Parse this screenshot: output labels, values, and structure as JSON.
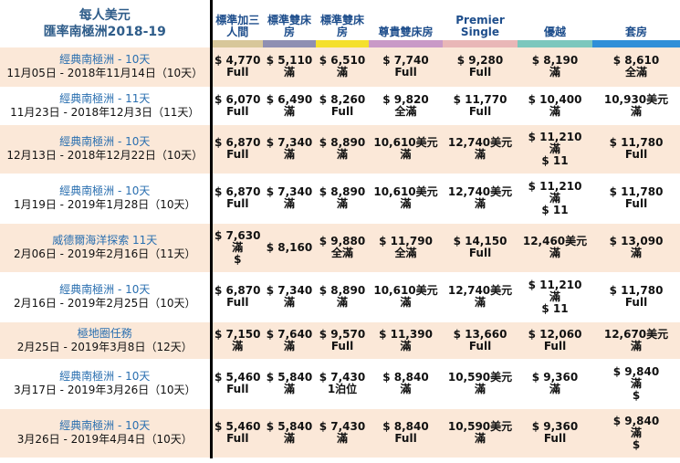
{
  "header": {
    "title": "每人美元",
    "subtitle": "匯率南極洲2018-19",
    "columns": [
      {
        "label": "標準加三人間",
        "color": "#d8c79a"
      },
      {
        "label": "標準雙床房",
        "color": "#8f8fb2"
      },
      {
        "label": "標準雙床房",
        "color": "#f4e02d"
      },
      {
        "label": "尊貴雙床房",
        "color": "#c99ac7"
      },
      {
        "label": "Premier Single",
        "color": "#e9b7b7"
      },
      {
        "label": "優越",
        "color": "#7cc7bd"
      },
      {
        "label": "套房",
        "color": "#2f8fd8"
      }
    ]
  },
  "rows": [
    {
      "tour": "經典南極洲 - 10天",
      "dates": "11月05日 - 2018年11月14日（10天）",
      "cells": [
        [
          "$ 4,770",
          "Full"
        ],
        [
          "$ 5,110",
          "滿"
        ],
        [
          "$ 6,510",
          "滿"
        ],
        [
          "$ 7,740",
          "Full"
        ],
        [
          "$ 9,280",
          "Full"
        ],
        [
          "$ 8,190",
          "滿"
        ],
        [
          "$ 8,610",
          "全滿"
        ]
      ]
    },
    {
      "tour": "經典南極洲 - 11天",
      "dates": "11月23日 - 2018年12月3日（11天）",
      "cells": [
        [
          "$ 6,070",
          "Full"
        ],
        [
          "$ 6,490",
          "滿"
        ],
        [
          "$ 8,260",
          "Full"
        ],
        [
          "$ 9,820",
          "全滿"
        ],
        [
          "$ 11,770",
          "Full"
        ],
        [
          "$ 10,400",
          "滿"
        ],
        [
          "10,930美元",
          "滿"
        ]
      ]
    },
    {
      "tour": "經典南極洲 - 10天",
      "dates": "12月13日 - 2018年12月22日（10天）",
      "cells": [
        [
          "$ 6,870",
          "Full"
        ],
        [
          "$ 7,340",
          "滿"
        ],
        [
          "$ 8,890",
          "滿"
        ],
        [
          "10,610美元",
          "滿"
        ],
        [
          "12,740美元",
          "滿"
        ],
        [
          "$ 11,210",
          "滿",
          "$ 11"
        ],
        [
          "$ 11,780",
          "Full"
        ]
      ]
    },
    {
      "tour": "經典南極洲 - 10天",
      "dates": "1月19日 - 2019年1月28日（10天）",
      "cells": [
        [
          "$ 6,870",
          "Full"
        ],
        [
          "$ 7,340",
          "滿"
        ],
        [
          "$ 8,890",
          "滿"
        ],
        [
          "10,610美元",
          "滿"
        ],
        [
          "12,740美元",
          "滿"
        ],
        [
          "$ 11,210",
          "滿",
          "$ 11"
        ],
        [
          "$ 11,780",
          "Full"
        ]
      ]
    },
    {
      "tour": "威德爾海洋探索 11天",
      "dates": "2月06日 - 2019年2月16日（11天）",
      "cells": [
        [
          "$ 7,630",
          "滿",
          "$"
        ],
        [
          "$ 8,160"
        ],
        [
          "$ 9,880",
          "全滿"
        ],
        [
          "$ 11,790",
          "全滿"
        ],
        [
          "$ 14,150",
          "Full"
        ],
        [
          "12,460美元",
          "滿"
        ],
        [
          "$ 13,090",
          "滿"
        ]
      ]
    },
    {
      "tour": "經典南極洲 - 10天",
      "dates": "2月16日 - 2019年2月25日（10天）",
      "cells": [
        [
          "$ 6,870",
          "Full"
        ],
        [
          "$ 7,340",
          "滿"
        ],
        [
          "$ 8,890",
          "滿"
        ],
        [
          "10,610美元",
          "滿"
        ],
        [
          "12,740美元",
          "滿"
        ],
        [
          "$ 11,210",
          "滿",
          "$ 11"
        ],
        [
          "$ 11,780",
          "Full"
        ]
      ]
    },
    {
      "tour": "極地圈任務",
      "dates": "2月25日 - 2019年3月8日（12天）",
      "cells": [
        [
          "$ 7,150",
          "滿"
        ],
        [
          "$ 7,640",
          "滿"
        ],
        [
          "$ 9,570",
          "Full"
        ],
        [
          "$ 11,390",
          "滿"
        ],
        [
          "$ 13,660",
          "Full"
        ],
        [
          "$ 12,060",
          "Full"
        ],
        [
          "12,670美元",
          "滿"
        ]
      ]
    },
    {
      "tour": "經典南極洲 - 10天",
      "dates": "3月17日 - 2019年3月26日（10天）",
      "cells": [
        [
          "$ 5,460",
          "Full"
        ],
        [
          "$ 5,840",
          "滿"
        ],
        [
          "$ 7,430",
          "1泊位"
        ],
        [
          "$ 8,840",
          "滿"
        ],
        [
          "10,590美元",
          "滿"
        ],
        [
          "$ 9,360",
          "滿"
        ],
        [
          "$ 9,840",
          "滿",
          "$"
        ]
      ]
    },
    {
      "tour": "經典南極洲 - 10天",
      "dates": "3月26日 - 2019年4月4日（10天）",
      "cells": [
        [
          "$ 5,460",
          "Full"
        ],
        [
          "$ 5,840",
          "滿"
        ],
        [
          "$ 7,430",
          "滿"
        ],
        [
          "$ 8,840",
          "Full"
        ],
        [
          "10,590美元",
          "滿"
        ],
        [
          "$ 9,360",
          "Full"
        ],
        [
          "$ 9,840",
          "滿",
          "$"
        ]
      ]
    }
  ]
}
